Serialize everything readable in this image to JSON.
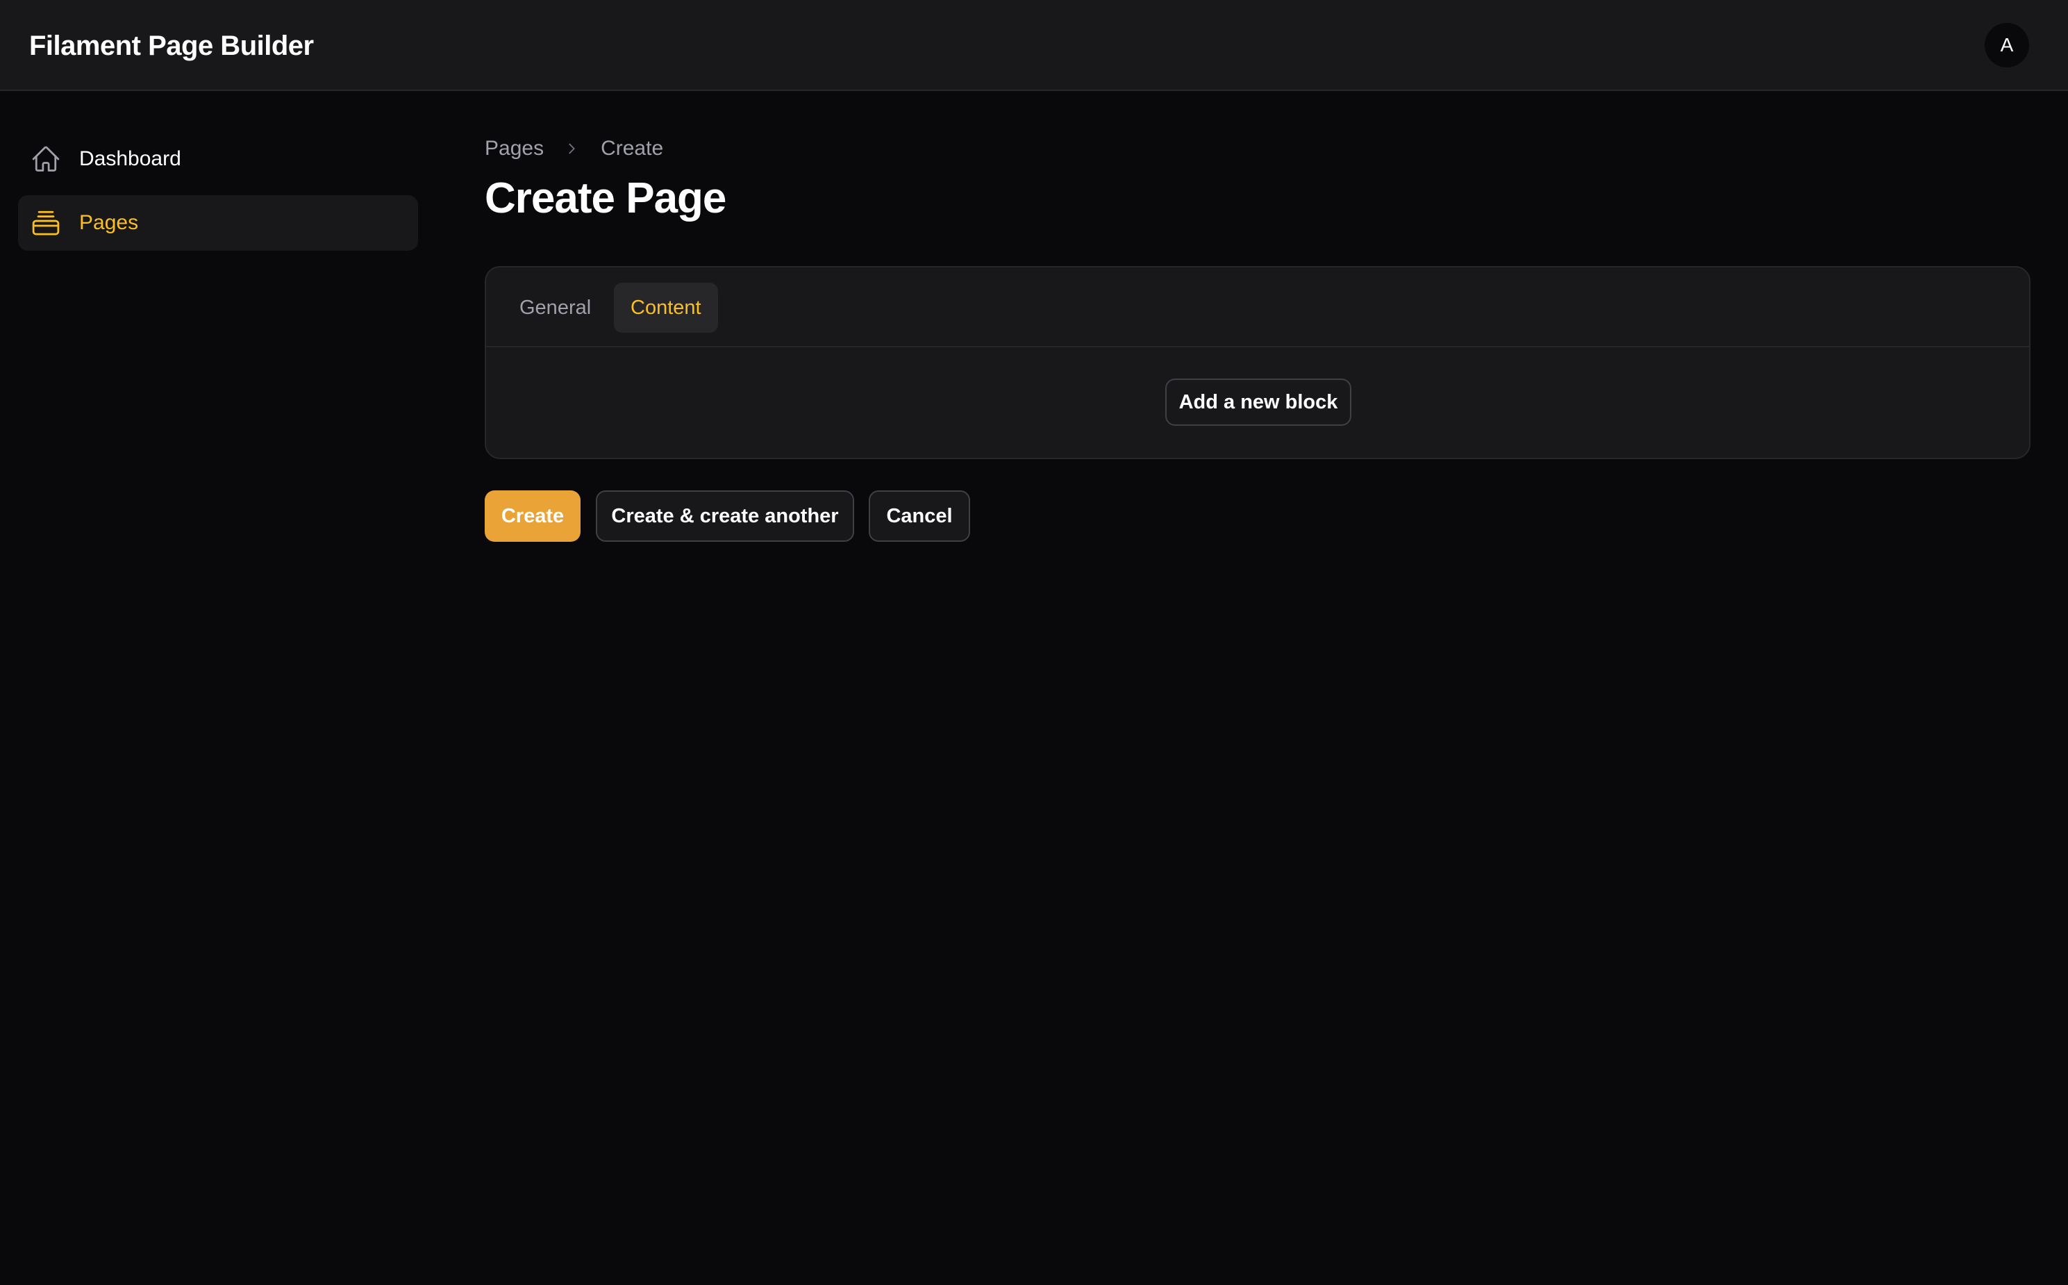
{
  "app": {
    "title": "Filament Page Builder",
    "avatar_initial": "A"
  },
  "sidebar": {
    "items": [
      {
        "label": "Dashboard",
        "icon": "home-icon",
        "active": false
      },
      {
        "label": "Pages",
        "icon": "pages-stack-icon",
        "active": true
      }
    ]
  },
  "breadcrumb": {
    "items": [
      "Pages",
      "Create"
    ],
    "separator_icon": "chevron-right-icon"
  },
  "page": {
    "title": "Create Page"
  },
  "form": {
    "tabs": [
      {
        "label": "General",
        "active": false
      },
      {
        "label": "Content",
        "active": true
      }
    ],
    "add_block_label": "Add a new block"
  },
  "actions": {
    "create_label": "Create",
    "create_another_label": "Create & create another",
    "cancel_label": "Cancel"
  },
  "colors": {
    "accent": "#fbbf24",
    "primary_button": "#eaa336",
    "background": "#09090b",
    "surface": "#18181b"
  }
}
